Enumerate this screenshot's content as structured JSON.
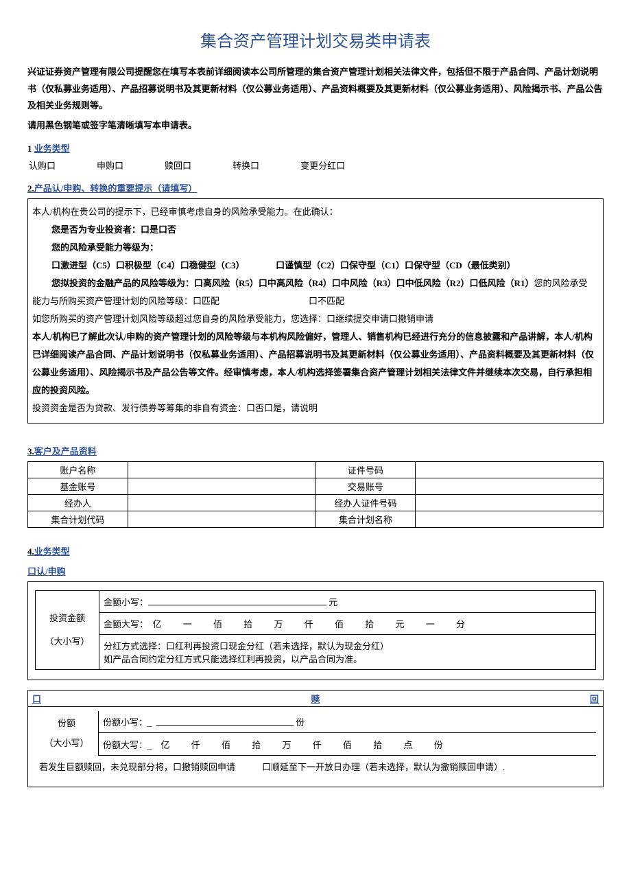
{
  "title": "集合资产管理计划交易类申请表",
  "intro": "兴证证券资产管理有限公司提醒您在填写本表前详细阅读本公司所管理的集合资产管理计划相关法律文件，包括但不限于产品合同、产品计划说明书（仅私募业务适用）、产品招募说明书及其更新材料（仅公募业务适用）、产品资料概要及其更新材料（仅公募业务适用）、风险揭示书、产品公告及相关业务规则等。",
  "intro2": "请用黑色钢笔或签字笔清晰填写本申请表。",
  "s1": {
    "num": "1",
    "title": "业务类型",
    "opt1": "认购口",
    "opt2": "申购口",
    "opt3": "赎回口",
    "opt4": "转换口",
    "opt5": "变更分红口"
  },
  "s2": {
    "num": "2.",
    "title": "产品认/申购、转换的重要提示（请填写）",
    "l1": "本人/机构在贵公司的提示下，已经审慎考虑自身的风险承受能力。在此确认：",
    "l2": "您是否为专业投资者：口是口否",
    "l3": "您的风险承受能力等级为：",
    "l4": "口激进型（C5）口积极型（C4）口稳健型（C3）　　　　口谨慎型（C2）口保守型（C1）口保守型（CD（最低类别）",
    "l5_a": "您拟投资的金融产品的风险等级为：口高风险（R5）口中高风险（R4）口中风险（R3）口中低风险（R2）口低风险（R1）",
    "l5_b": "您的风险承受",
    "l6": "能力与所购买资产管理计划的风险等级：口匹配　　　　　　　　　　口不匹配",
    "l7": "如您所购买的资产管理计划风险等级超过您自身的风险承受能力，您选择：口继续提交申请口撤销申请",
    "l8": "本人/机构已了解此次认/申购的资产管理计划的风险等级与本机构风险偏好，管理人、销售机构已经进行充分的信息披露和产品讲解，本人/机构已详细阅读产品合同、产品计划说明书（仅私募业务适用）、产品招募说明书及其更新材料（仅公募业务适用）、产品资料概要及其更新材料（仅公募业务适用）、风险揭示书及产品公告等文件。经审慎考虑，本人/机构选择签署集合资产管理计划相关法律文件并继续本次交易，自行承担相应的投资风险。",
    "l9": "投资资金是否为贷款、发行债券等筹集的非自有资金：口否口是，请说明"
  },
  "s3": {
    "num": "3.",
    "title": "客户及产品资料",
    "r1a": "账户名称",
    "r1b": "证件号码",
    "r2a": "基金账号",
    "r2b": "交易账号",
    "r3a": "经办人",
    "r3b": "经办人证件号码",
    "r4a": "集合计划代码",
    "r4b": "集合计划名称"
  },
  "s4": {
    "num": "4.",
    "title": "业务类型",
    "sub": "口认/申购",
    "label1": "投资金额",
    "label2": "（大小写）",
    "row1a": "金额小写：",
    "row1b": "元",
    "row2a": "金额大写：",
    "units": "亿 一 佰 拾 万 仟 佰 拾 元 一 分",
    "row3a": "分红方式选择：口红利再投资口现金分红（若未选择，默认为现金分红）",
    "row3b": "如产品合同约定分红方式只能选择红利再投资，以产品合同为准。"
  },
  "s5": {
    "left": "口",
    "mid": "赎",
    "right": "回",
    "label1": "份额",
    "label2": "（大小写）",
    "row1a": "份额小写：_",
    "row1b": "份",
    "row2a": "份额大写：_",
    "units": "亿 仟 佰 拾 万 仟 佰 拾 点 份",
    "row3": "若发生巨额赎回，未兑现部分将，口撤销赎回申请　　　口顺延至下一开放日办理（若未选择，默认为撤销赎回申请）."
  }
}
